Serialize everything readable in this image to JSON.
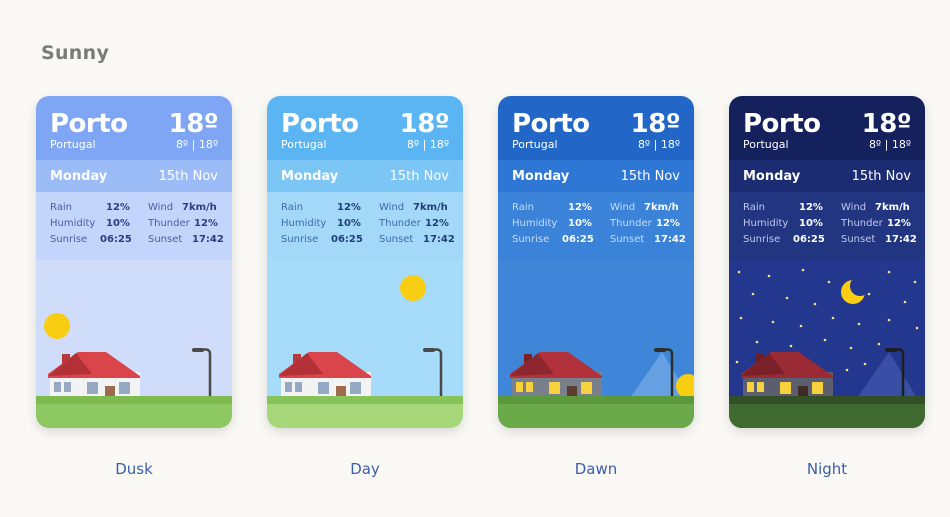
{
  "page_title": "Sunny",
  "cards": [
    {
      "caption": "Dusk",
      "city": "Porto",
      "country": "Portugal",
      "temperature": "18º",
      "range": "8º | 18º",
      "day": "Monday",
      "date": "15th Nov",
      "stats": {
        "rain_label": "Rain",
        "rain_value": "12%",
        "humidity_label": "Humidity",
        "humidity_value": "10%",
        "sunrise_label": "Sunrise",
        "sunrise_value": "06:25",
        "wind_label": "Wind",
        "wind_value": "7km/h",
        "thunder_label": "Thunder",
        "thunder_value": "12%",
        "sunset_label": "Sunset",
        "sunset_value": "17:42"
      },
      "colors": {
        "header": "#7ea6f4",
        "day_bar": "#9cbcf8",
        "stats": "#c3d5fb",
        "sky": "#cfdcfa",
        "stat_label": "#4a5fa0",
        "stat_value": "#2c3e80"
      }
    },
    {
      "caption": "Day",
      "city": "Porto",
      "country": "Portugal",
      "temperature": "18º",
      "range": "8º | 18º",
      "day": "Monday",
      "date": "15th Nov",
      "stats": {
        "rain_label": "Rain",
        "rain_value": "12%",
        "humidity_label": "Humidity",
        "humidity_value": "10%",
        "sunrise_label": "Sunrise",
        "sunrise_value": "06:25",
        "wind_label": "Wind",
        "wind_value": "7km/h",
        "thunder_label": "Thunder",
        "thunder_value": "12%",
        "sunset_label": "Sunset",
        "sunset_value": "17:42"
      },
      "colors": {
        "header": "#5bb5f3",
        "day_bar": "#7cc6f6",
        "stats": "#a3d8f8",
        "sky": "#a7dbfa",
        "stat_label": "#3a6ea8",
        "stat_value": "#1f3f78"
      }
    },
    {
      "caption": "Dawn",
      "city": "Porto",
      "country": "Portugal",
      "temperature": "18º",
      "range": "8º | 18º",
      "day": "Monday",
      "date": "15th Nov",
      "stats": {
        "rain_label": "Rain",
        "rain_value": "12%",
        "humidity_label": "Humidity",
        "humidity_value": "10%",
        "sunrise_label": "Sunrise",
        "sunrise_value": "06:25",
        "wind_label": "Wind",
        "wind_value": "7km/h",
        "thunder_label": "Thunder",
        "thunder_value": "12%",
        "sunset_label": "Sunset",
        "sunset_value": "17:42"
      },
      "colors": {
        "header": "#2267c8",
        "day_bar": "#2f77d4",
        "stats": "#3b82d9",
        "sky": "#3f86d8",
        "stat_label": "#c8dcf6",
        "stat_value": "#ffffff"
      }
    },
    {
      "caption": "Night",
      "city": "Porto",
      "country": "Portugal",
      "temperature": "18º",
      "range": "8º | 18º",
      "day": "Monday",
      "date": "15th Nov",
      "stats": {
        "rain_label": "Rain",
        "rain_value": "12%",
        "humidity_label": "Humidity",
        "humidity_value": "10%",
        "sunrise_label": "Sunrise",
        "sunrise_value": "06:25",
        "wind_label": "Wind",
        "wind_value": "7km/h",
        "thunder_label": "Thunder",
        "thunder_value": "12%",
        "sunset_label": "Sunset",
        "sunset_value": "17:42"
      },
      "colors": {
        "header": "#14215d",
        "day_bar": "#1b2c72",
        "stats": "#223581",
        "sky": "#24378f",
        "stat_label": "#c0c8ea",
        "stat_value": "#ffffff"
      }
    }
  ]
}
